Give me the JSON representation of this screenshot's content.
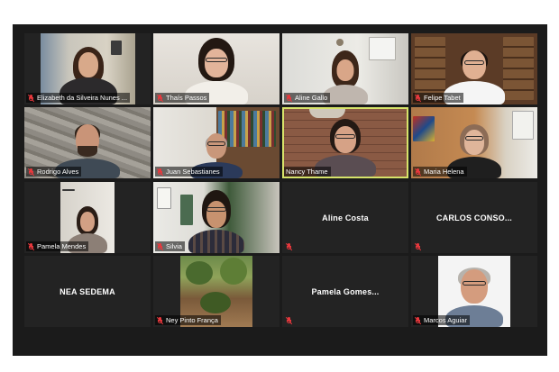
{
  "participants": [
    {
      "name": "Elizabeth da Silveira Nunes ...",
      "muted": true,
      "video": true
    },
    {
      "name": "Thaís Passos",
      "muted": true,
      "video": true
    },
    {
      "name": "Aline Gallo",
      "muted": true,
      "video": true
    },
    {
      "name": "Felipe Tabet",
      "muted": true,
      "video": true
    },
    {
      "name": "Rodrigo Alves",
      "muted": true,
      "video": true
    },
    {
      "name": "Juan Sebastianes",
      "muted": true,
      "video": true
    },
    {
      "name": "Nancy Thame",
      "muted": false,
      "video": true,
      "active_speaker": true
    },
    {
      "name": "Maria Helena",
      "muted": true,
      "video": true
    },
    {
      "name": "Pamela Mendes",
      "muted": true,
      "video": true
    },
    {
      "name": "Silvia",
      "muted": true,
      "video": true
    },
    {
      "display_name": "Aline Costa",
      "muted": true,
      "video": false
    },
    {
      "display_name": "CARLOS CONSO...",
      "muted": true,
      "video": false
    },
    {
      "display_name": "NEA SEDEMA",
      "muted": false,
      "video": false
    },
    {
      "name": "Ney Pinto França",
      "muted": true,
      "video": true
    },
    {
      "display_name": "Pamela Gomes...",
      "muted": true,
      "video": false
    },
    {
      "name": "Marcos Aguiar",
      "muted": true,
      "video": true
    }
  ],
  "colors": {
    "background": "#1b1b1b",
    "tile": "#232323",
    "active_speaker_border": "#d6e36a",
    "muted_icon": "#e8383d"
  },
  "icons": {
    "muted": "microphone-muted-icon"
  }
}
